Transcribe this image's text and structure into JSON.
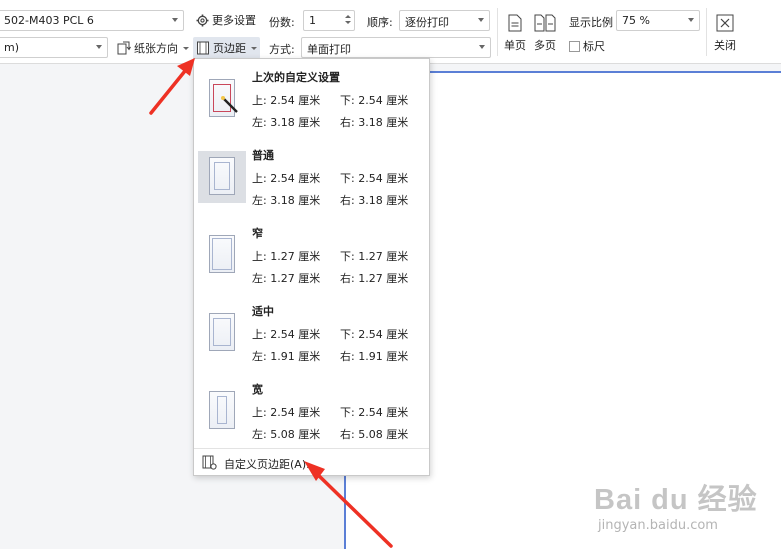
{
  "toolbar": {
    "printer_name": "502-M403 PCL 6",
    "paper_size": "m)",
    "more_settings_label": "更多设置",
    "orientation_label": "纸张方向",
    "margins_label": "页边距",
    "copies_label": "份数:",
    "copies_value": "1",
    "order_label": "顺序:",
    "order_value": "逐份打印",
    "mode_label": "方式:",
    "mode_value": "单面打印",
    "single_page_label": "单页",
    "multi_page_label": "多页",
    "zoom_label": "显示比例",
    "zoom_value": "75 %",
    "ruler_label": "标尺",
    "close_label": "关闭"
  },
  "margins_menu": {
    "presets": [
      {
        "name": "上次的自定义设置",
        "top": "上: 2.54 厘米",
        "bottom": "下: 2.54 厘米",
        "left": "左: 3.18 厘米",
        "right": "右: 3.18 厘米"
      },
      {
        "name": "普通",
        "top": "上: 2.54 厘米",
        "bottom": "下: 2.54 厘米",
        "left": "左: 3.18 厘米",
        "right": "右: 3.18 厘米"
      },
      {
        "name": "窄",
        "top": "上: 1.27 厘米",
        "bottom": "下: 1.27 厘米",
        "left": "左: 1.27 厘米",
        "right": "右: 1.27 厘米"
      },
      {
        "name": "适中",
        "top": "上: 2.54 厘米",
        "bottom": "下: 2.54 厘米",
        "left": "左: 1.91 厘米",
        "right": "右: 1.91 厘米"
      },
      {
        "name": "宽",
        "top": "上: 2.54 厘米",
        "bottom": "下: 2.54 厘米",
        "left": "左: 5.08 厘米",
        "right": "右: 5.08 厘米"
      }
    ],
    "custom_label": "自定义页边距(A)..."
  },
  "watermark": {
    "logo": "Bai du 经验",
    "url": "jingyan.baidu.com"
  },
  "colors": {
    "arrow": "#ee3124",
    "page_border": "#5b7fd6",
    "selected_bg": "#dcdfe4"
  }
}
